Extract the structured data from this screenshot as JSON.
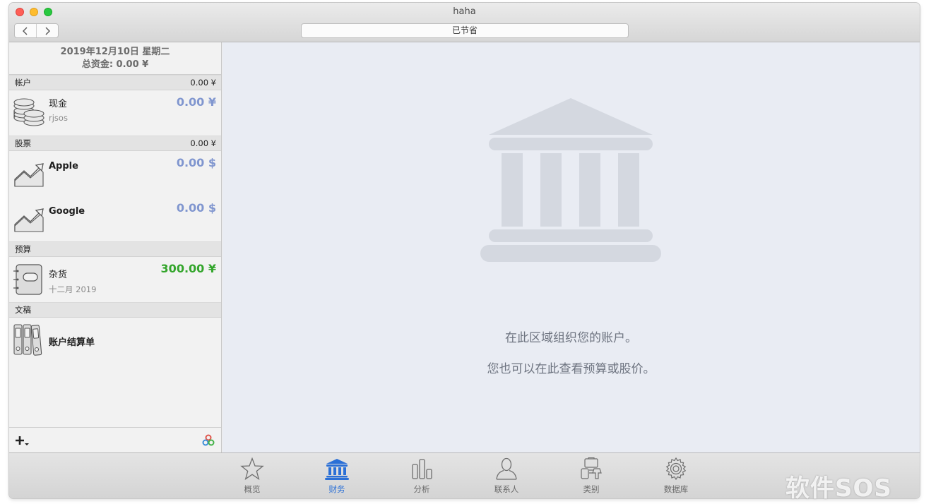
{
  "window": {
    "title": "haha"
  },
  "toolbar": {
    "back_icon": "chevron-left-icon",
    "forward_icon": "chevron-right-icon",
    "status_text": "已节省"
  },
  "sidebar": {
    "date": "2019年12月10日 星期二",
    "total": "总资金: 0.00 ¥",
    "sections": {
      "accounts": {
        "label": "帐户",
        "total": "0.00 ¥",
        "items": [
          {
            "title": "现金",
            "subtitle": "rjsos",
            "value": "0.00 ¥",
            "icon": "coins-icon"
          }
        ]
      },
      "stocks": {
        "label": "股票",
        "total": "0.00 ¥",
        "items": [
          {
            "title": "Apple",
            "value": "0.00 $",
            "icon": "trend-up-icon"
          },
          {
            "title": "Google",
            "value": "0.00 $",
            "icon": "trend-up-icon"
          }
        ]
      },
      "budget": {
        "label": "预算",
        "items": [
          {
            "title": "杂货",
            "subtitle": "十二月 2019",
            "value": "300.00 ¥",
            "icon": "wallet-icon"
          }
        ]
      },
      "documents": {
        "label": "文稿",
        "items": [
          {
            "title": "账户结算单",
            "icon": "binders-icon"
          }
        ]
      }
    },
    "footer": {
      "add_icon": "add-menu-icon",
      "share_icon": "colored-circles-icon"
    }
  },
  "content": {
    "illustration": "bank-building-icon",
    "message_1": "在此区域组织您的账户。",
    "message_2": "您也可以在此查看预算或股价。"
  },
  "tabs": [
    {
      "label": "概览",
      "icon": "star-icon",
      "active": false
    },
    {
      "label": "财务",
      "icon": "bank-icon",
      "active": true
    },
    {
      "label": "分析",
      "icon": "bar-chart-icon",
      "active": false
    },
    {
      "label": "联系人",
      "icon": "person-icon",
      "active": false
    },
    {
      "label": "类别",
      "icon": "categories-icon",
      "active": false
    },
    {
      "label": "数据库",
      "icon": "gear-icon",
      "active": false
    }
  ],
  "colors": {
    "accent": "#2a6fd6",
    "value_blue": "#8096cf",
    "value_green": "#33a52b",
    "content_bg": "#e9ecf3"
  },
  "watermark": "软件SOS"
}
